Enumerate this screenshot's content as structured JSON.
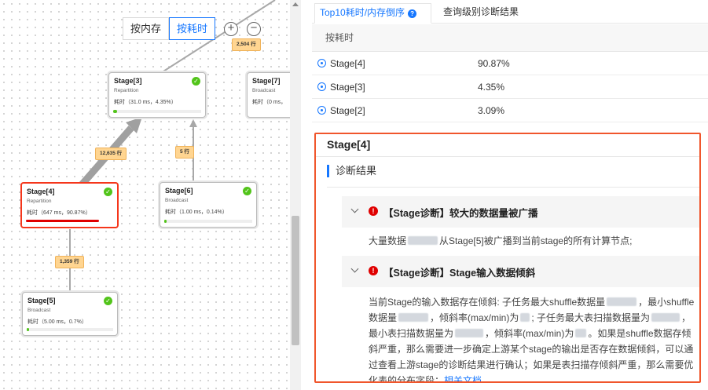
{
  "toolbar": {
    "sort_memory": "按内存",
    "sort_time": "按耗时",
    "zoom_in": "+",
    "zoom_out": "−"
  },
  "graph": {
    "nodes": [
      {
        "id": "stage3",
        "title": "Stage[3]",
        "type": "Repartition",
        "time": "耗时（31.0 ms，4.35%）",
        "progress": 0.0435
      },
      {
        "id": "stage7",
        "title": "Stage[7]",
        "type": "Broadcast",
        "time": "耗时（0 ms，",
        "progress": 0
      },
      {
        "id": "stage4",
        "title": "Stage[4]",
        "type": "Repartition",
        "time": "耗时（647 ms，90.87%）",
        "progress": 0.9087
      },
      {
        "id": "stage6",
        "title": "Stage[6]",
        "type": "Broadcast",
        "time": "耗时（1.00 ms，0.14%）",
        "progress": 0.0014
      },
      {
        "id": "stage5",
        "title": "Stage[5]",
        "type": "Broadcast",
        "time": "耗时（5.00 ms，0.7%）",
        "progress": 0.007
      }
    ],
    "edges": [
      {
        "label": "2,504 行"
      },
      {
        "label": "12,635 行"
      },
      {
        "label": "5 行"
      },
      {
        "label": "1,359 行"
      }
    ]
  },
  "panel": {
    "tabs": [
      {
        "label": "Top10耗时/内存倒序"
      },
      {
        "label": "查询级别诊断结果"
      }
    ],
    "rank_header": "按耗时",
    "rank_rows": [
      {
        "stage": "Stage[4]",
        "value": "90.87%"
      },
      {
        "stage": "Stage[3]",
        "value": "4.35%"
      },
      {
        "stage": "Stage[2]",
        "value": "3.09%"
      }
    ],
    "diag": {
      "title": "Stage[4]",
      "section": "诊断结果",
      "issue1": {
        "title": "【Stage诊断】较大的数据量被广播",
        "body_a": "大量数据",
        "body_b": "从Stage[5]被广播到当前stage的所有计算节点;"
      },
      "issue2": {
        "title": "【Stage诊断】Stage输入数据倾斜",
        "t1": "当前Stage的输入数据存在倾斜: 子任务最大shuffle数据量",
        "t2": "，最小shuffle数据量",
        "t3": "，倾斜率(max/min)为",
        "t4": "; 子任务最大表扫描数据量为",
        "t5": "，最小表扫描数据量为",
        "t6": "，倾斜率(max/min)为",
        "t7": "。如果是shuffle数据存倾斜严重，那么需要进一步确定上游某个stage的输出是否存在数据倾斜，可以通过查看上游stage的诊断结果进行确认；如果是表扫描存倾斜严重，那么需要优化表的分布字段：",
        "link": "相关文档"
      }
    }
  }
}
